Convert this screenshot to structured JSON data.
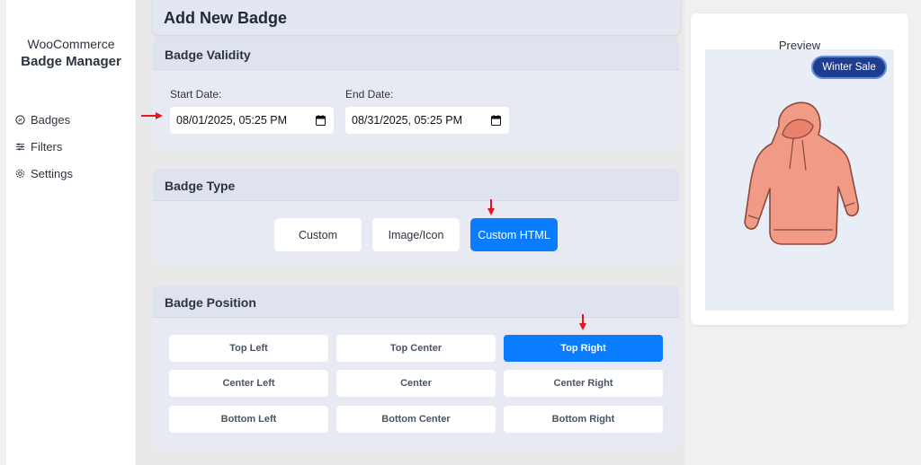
{
  "sidebar": {
    "brand_line1": "WooCommerce",
    "brand_line2": "Badge Manager",
    "items": [
      {
        "label": "Badges",
        "icon": "badge-icon"
      },
      {
        "label": "Filters",
        "icon": "filters-icon"
      },
      {
        "label": "Settings",
        "icon": "gear-icon"
      }
    ]
  },
  "page": {
    "title": "Add New Badge"
  },
  "validity": {
    "heading": "Badge Validity",
    "start_label": "Start Date:",
    "start_value": "08/01/2025, 05:25 PM",
    "end_label": "End Date:",
    "end_value": "08/31/2025, 05:25 PM"
  },
  "badge_type": {
    "heading": "Badge Type",
    "options": [
      "Custom",
      "Image/Icon",
      "Custom HTML"
    ],
    "selected": "Custom HTML"
  },
  "badge_position": {
    "heading": "Badge Position",
    "options": [
      "Top Left",
      "Top Center",
      "Top Right",
      "Center Left",
      "Center",
      "Center Right",
      "Bottom Left",
      "Bottom Center",
      "Bottom Right"
    ],
    "selected": "Top Right"
  },
  "preview": {
    "title": "Preview",
    "badge_text": "Winter Sale",
    "product_image": "hoodie-illustration"
  },
  "colors": {
    "accent": "#0a7cff",
    "badge_bg": "#1e3d8f",
    "annotation_arrow": "#e8141b"
  }
}
